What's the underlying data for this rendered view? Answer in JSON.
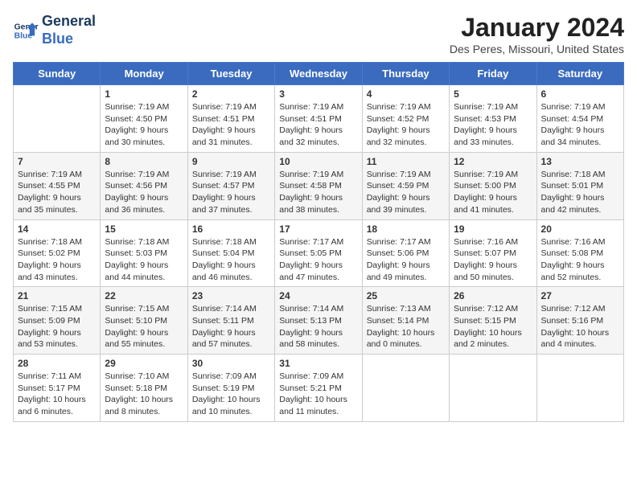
{
  "header": {
    "logo_line1": "General",
    "logo_line2": "Blue",
    "month_year": "January 2024",
    "location": "Des Peres, Missouri, United States"
  },
  "weekdays": [
    "Sunday",
    "Monday",
    "Tuesday",
    "Wednesday",
    "Thursday",
    "Friday",
    "Saturday"
  ],
  "weeks": [
    [
      {
        "day": "",
        "sunrise": "",
        "sunset": "",
        "daylight": ""
      },
      {
        "day": "1",
        "sunrise": "Sunrise: 7:19 AM",
        "sunset": "Sunset: 4:50 PM",
        "daylight": "Daylight: 9 hours and 30 minutes."
      },
      {
        "day": "2",
        "sunrise": "Sunrise: 7:19 AM",
        "sunset": "Sunset: 4:51 PM",
        "daylight": "Daylight: 9 hours and 31 minutes."
      },
      {
        "day": "3",
        "sunrise": "Sunrise: 7:19 AM",
        "sunset": "Sunset: 4:51 PM",
        "daylight": "Daylight: 9 hours and 32 minutes."
      },
      {
        "day": "4",
        "sunrise": "Sunrise: 7:19 AM",
        "sunset": "Sunset: 4:52 PM",
        "daylight": "Daylight: 9 hours and 32 minutes."
      },
      {
        "day": "5",
        "sunrise": "Sunrise: 7:19 AM",
        "sunset": "Sunset: 4:53 PM",
        "daylight": "Daylight: 9 hours and 33 minutes."
      },
      {
        "day": "6",
        "sunrise": "Sunrise: 7:19 AM",
        "sunset": "Sunset: 4:54 PM",
        "daylight": "Daylight: 9 hours and 34 minutes."
      }
    ],
    [
      {
        "day": "7",
        "sunrise": "Sunrise: 7:19 AM",
        "sunset": "Sunset: 4:55 PM",
        "daylight": "Daylight: 9 hours and 35 minutes."
      },
      {
        "day": "8",
        "sunrise": "Sunrise: 7:19 AM",
        "sunset": "Sunset: 4:56 PM",
        "daylight": "Daylight: 9 hours and 36 minutes."
      },
      {
        "day": "9",
        "sunrise": "Sunrise: 7:19 AM",
        "sunset": "Sunset: 4:57 PM",
        "daylight": "Daylight: 9 hours and 37 minutes."
      },
      {
        "day": "10",
        "sunrise": "Sunrise: 7:19 AM",
        "sunset": "Sunset: 4:58 PM",
        "daylight": "Daylight: 9 hours and 38 minutes."
      },
      {
        "day": "11",
        "sunrise": "Sunrise: 7:19 AM",
        "sunset": "Sunset: 4:59 PM",
        "daylight": "Daylight: 9 hours and 39 minutes."
      },
      {
        "day": "12",
        "sunrise": "Sunrise: 7:19 AM",
        "sunset": "Sunset: 5:00 PM",
        "daylight": "Daylight: 9 hours and 41 minutes."
      },
      {
        "day": "13",
        "sunrise": "Sunrise: 7:18 AM",
        "sunset": "Sunset: 5:01 PM",
        "daylight": "Daylight: 9 hours and 42 minutes."
      }
    ],
    [
      {
        "day": "14",
        "sunrise": "Sunrise: 7:18 AM",
        "sunset": "Sunset: 5:02 PM",
        "daylight": "Daylight: 9 hours and 43 minutes."
      },
      {
        "day": "15",
        "sunrise": "Sunrise: 7:18 AM",
        "sunset": "Sunset: 5:03 PM",
        "daylight": "Daylight: 9 hours and 44 minutes."
      },
      {
        "day": "16",
        "sunrise": "Sunrise: 7:18 AM",
        "sunset": "Sunset: 5:04 PM",
        "daylight": "Daylight: 9 hours and 46 minutes."
      },
      {
        "day": "17",
        "sunrise": "Sunrise: 7:17 AM",
        "sunset": "Sunset: 5:05 PM",
        "daylight": "Daylight: 9 hours and 47 minutes."
      },
      {
        "day": "18",
        "sunrise": "Sunrise: 7:17 AM",
        "sunset": "Sunset: 5:06 PM",
        "daylight": "Daylight: 9 hours and 49 minutes."
      },
      {
        "day": "19",
        "sunrise": "Sunrise: 7:16 AM",
        "sunset": "Sunset: 5:07 PM",
        "daylight": "Daylight: 9 hours and 50 minutes."
      },
      {
        "day": "20",
        "sunrise": "Sunrise: 7:16 AM",
        "sunset": "Sunset: 5:08 PM",
        "daylight": "Daylight: 9 hours and 52 minutes."
      }
    ],
    [
      {
        "day": "21",
        "sunrise": "Sunrise: 7:15 AM",
        "sunset": "Sunset: 5:09 PM",
        "daylight": "Daylight: 9 hours and 53 minutes."
      },
      {
        "day": "22",
        "sunrise": "Sunrise: 7:15 AM",
        "sunset": "Sunset: 5:10 PM",
        "daylight": "Daylight: 9 hours and 55 minutes."
      },
      {
        "day": "23",
        "sunrise": "Sunrise: 7:14 AM",
        "sunset": "Sunset: 5:11 PM",
        "daylight": "Daylight: 9 hours and 57 minutes."
      },
      {
        "day": "24",
        "sunrise": "Sunrise: 7:14 AM",
        "sunset": "Sunset: 5:13 PM",
        "daylight": "Daylight: 9 hours and 58 minutes."
      },
      {
        "day": "25",
        "sunrise": "Sunrise: 7:13 AM",
        "sunset": "Sunset: 5:14 PM",
        "daylight": "Daylight: 10 hours and 0 minutes."
      },
      {
        "day": "26",
        "sunrise": "Sunrise: 7:12 AM",
        "sunset": "Sunset: 5:15 PM",
        "daylight": "Daylight: 10 hours and 2 minutes."
      },
      {
        "day": "27",
        "sunrise": "Sunrise: 7:12 AM",
        "sunset": "Sunset: 5:16 PM",
        "daylight": "Daylight: 10 hours and 4 minutes."
      }
    ],
    [
      {
        "day": "28",
        "sunrise": "Sunrise: 7:11 AM",
        "sunset": "Sunset: 5:17 PM",
        "daylight": "Daylight: 10 hours and 6 minutes."
      },
      {
        "day": "29",
        "sunrise": "Sunrise: 7:10 AM",
        "sunset": "Sunset: 5:18 PM",
        "daylight": "Daylight: 10 hours and 8 minutes."
      },
      {
        "day": "30",
        "sunrise": "Sunrise: 7:09 AM",
        "sunset": "Sunset: 5:19 PM",
        "daylight": "Daylight: 10 hours and 10 minutes."
      },
      {
        "day": "31",
        "sunrise": "Sunrise: 7:09 AM",
        "sunset": "Sunset: 5:21 PM",
        "daylight": "Daylight: 10 hours and 11 minutes."
      },
      {
        "day": "",
        "sunrise": "",
        "sunset": "",
        "daylight": ""
      },
      {
        "day": "",
        "sunrise": "",
        "sunset": "",
        "daylight": ""
      },
      {
        "day": "",
        "sunrise": "",
        "sunset": "",
        "daylight": ""
      }
    ]
  ]
}
